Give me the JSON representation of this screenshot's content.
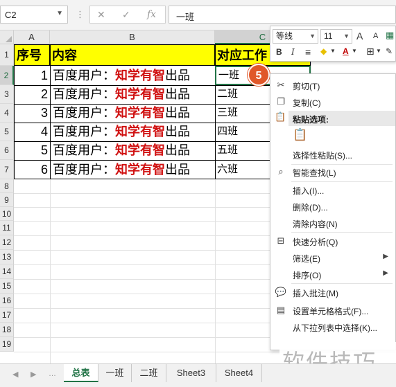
{
  "formula_bar": {
    "name_box": "C2",
    "cancel_icon": "✕",
    "confirm_icon": "✓",
    "fx_icon": "fx",
    "content": "一班"
  },
  "columns": [
    "A",
    "B",
    "C"
  ],
  "rows": [
    "1",
    "2",
    "3",
    "4",
    "5",
    "6",
    "7",
    "8",
    "9",
    "10",
    "11",
    "12",
    "13",
    "14",
    "15",
    "16",
    "17",
    "18",
    "19"
  ],
  "table": {
    "header": {
      "a": "序号",
      "b": "内容",
      "c": "对应工作"
    },
    "rows": [
      {
        "num": "1",
        "prefix": "百度用户：",
        "highlight": "知学有智",
        "suffix": "出品",
        "cls": "一班"
      },
      {
        "num": "2",
        "prefix": "百度用户：",
        "highlight": "知学有智",
        "suffix": "出品",
        "cls": "二班"
      },
      {
        "num": "3",
        "prefix": "百度用户：",
        "highlight": "知学有智",
        "suffix": "出品",
        "cls": "三班"
      },
      {
        "num": "4",
        "prefix": "百度用户：",
        "highlight": "知学有智",
        "suffix": "出品",
        "cls": "四班"
      },
      {
        "num": "5",
        "prefix": "百度用户：",
        "highlight": "知学有智",
        "suffix": "出品",
        "cls": "五班"
      },
      {
        "num": "6",
        "prefix": "百度用户：",
        "highlight": "知学有智",
        "suffix": "出品",
        "cls": "六班"
      }
    ]
  },
  "step_badge": "5",
  "mini_toolbar": {
    "font_name": "等线",
    "font_size": "11",
    "grow_font": "A",
    "shrink_font": "A",
    "bold": "B",
    "italic": "I",
    "align": "≡",
    "fill": "◆",
    "font_color": "A",
    "borders": "⊞",
    "format_painter": "✎"
  },
  "context_menu": {
    "cut": "剪切(T)",
    "copy": "复制(C)",
    "paste_options": "粘贴选项:",
    "paste_special": "选择性粘贴(S)...",
    "smart_lookup": "智能查找(L)",
    "insert": "插入(I)...",
    "delete": "删除(D)...",
    "clear_contents": "清除内容(N)",
    "quick_analysis": "快速分析(Q)",
    "filter": "筛选(E)",
    "sort": "排序(O)",
    "insert_comment": "插入批注(M)",
    "format_cells": "设置单元格格式(F)...",
    "pick_from_list": "从下拉列表中选择(K)..."
  },
  "watermark": "软件技巧",
  "sheet_tabs": [
    "总表",
    "一班",
    "二班",
    "Sheet3",
    "Sheet4"
  ],
  "active_sheet": "总表",
  "colors": {
    "accent": "#217346",
    "header_fill": "#ffff00",
    "highlight_text": "#d01010",
    "badge": "#e0582a"
  }
}
